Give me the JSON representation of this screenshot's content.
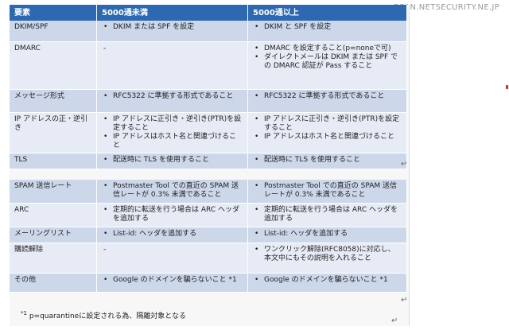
{
  "watermark": "SCAN.NETSECURITY.NE.JP",
  "table1": {
    "headers": [
      "要素",
      "5000通未満",
      "5000通以上"
    ],
    "rows": [
      {
        "label": "DKIM/SPF",
        "under": [
          "DKIM または SPF を設定"
        ],
        "over": [
          "DKIM と SPF を設定"
        ]
      },
      {
        "label": "DMARC",
        "under_dash": "-",
        "over": [
          "DMARC を設定すること(p=noneで可)",
          "ダイレクトメールは DKIM または SPF での DMARC 認証が Pass すること"
        ]
      },
      {
        "label": "メッセージ形式",
        "under": [
          "RFC5322 に準拠する形式であること"
        ],
        "over": [
          "RFC5322 に準拠する形式であること"
        ]
      },
      {
        "label": "IP アドレスの正・逆引き",
        "under": [
          "IP アドレスに正引き・逆引き(PTR)を設定すること",
          "IP アドレスはホスト名と関連づけること"
        ],
        "over": [
          "IP アドレスに正引き・逆引き(PTR)を設定すること",
          "IP アドレスはホスト名と関連づけること"
        ]
      },
      {
        "label": "TLS",
        "under": [
          "配送時に TLS を使用すること"
        ],
        "over": [
          "配送時に TLS を使用すること"
        ]
      }
    ]
  },
  "table2": {
    "rows": [
      {
        "label": "SPAM 送信レート",
        "under": [
          "Postmaster Tool での直近の SPAM 送信レートが 0.3% 未満であること"
        ],
        "over": [
          "Postmaster Tool での直近の SPAM 送信レートが 0.3% 未満であること"
        ]
      },
      {
        "label": "ARC",
        "under": [
          "定期的に転送を行う場合は ARC ヘッダを追加する"
        ],
        "over": [
          "定期的に転送を行う場合は ARC ヘッダを追加する"
        ]
      },
      {
        "label": "メーリングリスト",
        "under": [
          "List-id: ヘッダを追加する"
        ],
        "over": [
          "List-id: ヘッダを追加する"
        ]
      },
      {
        "label": "購読解除",
        "under_dash": "-",
        "over": [
          "ワンクリック解除(RFC8058)に対応し、本文中にもその説明を入れること"
        ]
      },
      {
        "label": "その他",
        "under": [
          "Google のドメインを騙らないこと *1"
        ],
        "over": [
          "Google のドメインを騙らないこと *1"
        ]
      }
    ]
  },
  "footnote": {
    "mark": "*1",
    "text": "p=quarantineに設定される為、隔離対象となる"
  },
  "return_mark": "↵"
}
